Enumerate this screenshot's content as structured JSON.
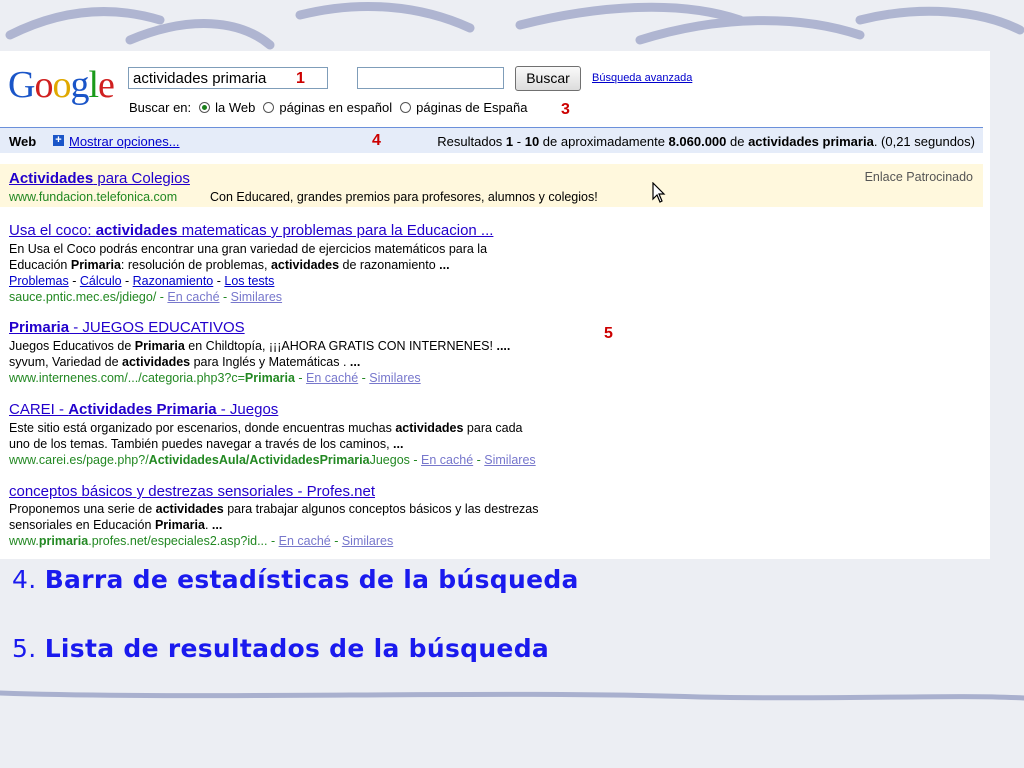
{
  "logo": {
    "text": "Google"
  },
  "search": {
    "query": "actividades primaria",
    "button": "Buscar",
    "advanced": "Búsqueda avanzada"
  },
  "radios": {
    "label": "Buscar en:",
    "options": [
      "la Web",
      "páginas en español",
      "páginas de España"
    ]
  },
  "markers": {
    "m1": "1",
    "m3": "3",
    "m4": "4",
    "m5": "5"
  },
  "stats": {
    "web": "Web",
    "options": "Mostrar opciones...",
    "prefix": "Resultados ",
    "range_a": "1",
    "dash": " - ",
    "range_b": "10",
    "mid": " de aproximadamente ",
    "total": "8.060.000",
    "de": " de ",
    "query": "actividades primaria",
    "time": ". (0,21 segundos)"
  },
  "sponsored": {
    "title_a": "Actividades",
    "title_b": " para Colegios",
    "url": "www.fundacion.telefonica.com",
    "desc": "Con Educared, grandes premios para profesores, alumnos y colegios!",
    "label": "Enlace Patrocinado"
  },
  "results": [
    {
      "title_a": "Usa el coco: ",
      "title_b": "actividades",
      "title_c": " matematicas y problemas para la Educacion ...",
      "s1": "En Usa el Coco podrás encontrar una gran variedad de ejercicios matemáticos para la",
      "s2a": "Educación ",
      "s2b": "Primaria",
      "s2c": ": resolución de problemas, ",
      "s2d": "actividades",
      "s2e": " de razonamiento ",
      "s2f": "...",
      "sub1": "Problemas",
      "sub2": "Cálculo",
      "sub3": "Razonamiento",
      "sub4": "Los tests",
      "url": "sauce.pntic.mec.es/jdiego/",
      "cache": "En caché",
      "sim": "Similares"
    },
    {
      "title_a": "Primaria",
      "title_b": " - JUEGOS EDUCATIVOS",
      "s1a": "Juegos Educativos de ",
      "s1b": "Primaria",
      "s1c": " en Childtopía, ¡¡¡AHORA GRATIS CON INTERNENES! ",
      "s1d": "....",
      "s2a": "syvum, Variedad de ",
      "s2b": "actividades",
      "s2c": " para Inglés y Matemáticas . ",
      "s2d": "...",
      "url_a": "www.internenes.com/.../categoria.php3?c=",
      "url_b": "Primaria",
      "cache": "En caché",
      "sim": "Similares"
    },
    {
      "title_a": "CAREI - ",
      "title_b": "Actividades Primaria",
      "title_c": " - Juegos",
      "s1a": "Este sitio está organizado por escenarios, donde encuentras muchas ",
      "s1b": "actividades",
      "s1c": " para cada",
      "s2a": "uno de los temas. También puedes navegar a través de los caminos, ",
      "s2b": "...",
      "url_a": "www.carei.es/page.php?/",
      "url_b": "ActividadesAula/ActividadesPrimaria",
      "url_c": "Juegos",
      "cache": "En caché",
      "sim": "Similares"
    },
    {
      "title": "conceptos básicos y destrezas sensoriales - Profes.net",
      "s1a": "Proponemos una serie de ",
      "s1b": "actividades",
      "s1c": " para trabajar algunos conceptos básicos y las destrezas",
      "s2a": "sensoriales en Educación ",
      "s2b": "Primaria",
      "s2c": ". ",
      "s2d": "...",
      "url_a": "www.",
      "url_b": "primaria",
      "url_c": ".profes.net/especiales2.asp?id...",
      "cache": "En caché",
      "sim": "Similares"
    }
  ],
  "captions": [
    {
      "num": "4. ",
      "text": "Barra de estadísticas de la búsqueda"
    },
    {
      "num": "5. ",
      "text": "Lista de resultados de la búsqueda"
    }
  ],
  "colors": {
    "link": "#2200cc",
    "url": "#228822",
    "marker": "#cc0000",
    "caption": "#1a1aee"
  }
}
